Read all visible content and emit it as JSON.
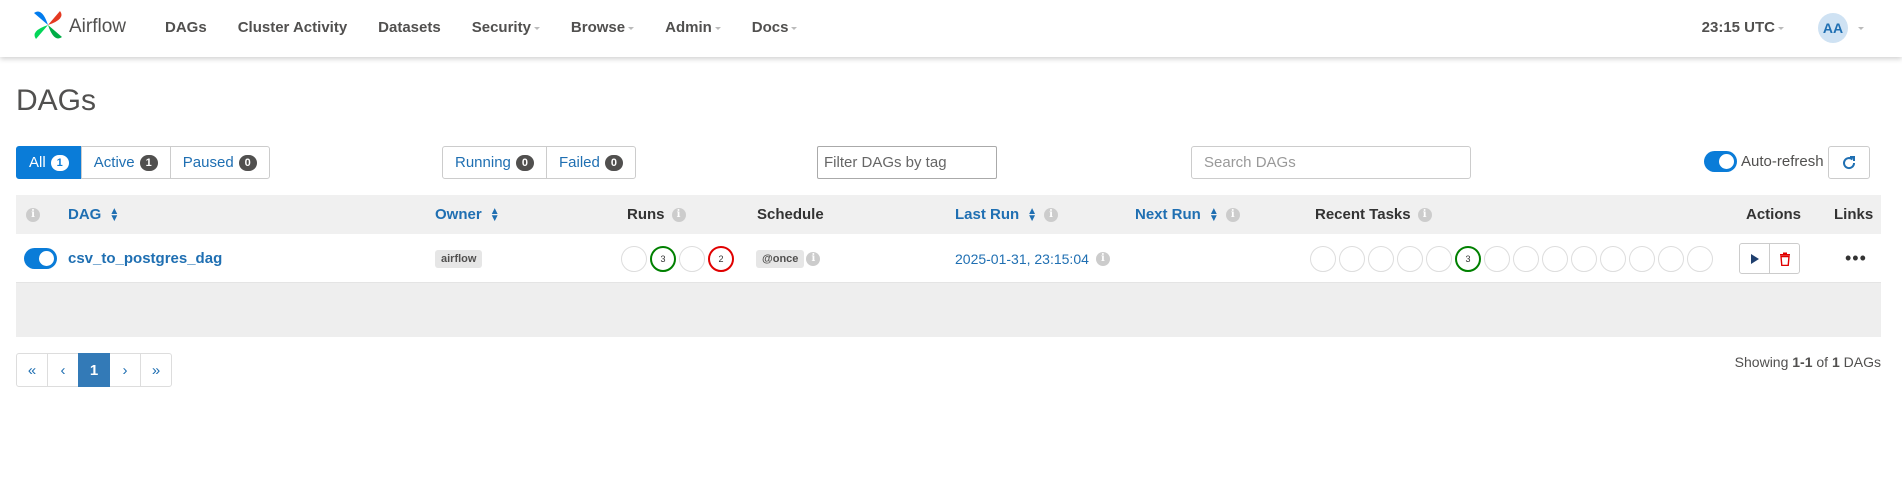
{
  "navbar": {
    "brand": "Airflow",
    "items": [
      {
        "label": "DAGs",
        "dropdown": false
      },
      {
        "label": "Cluster Activity",
        "dropdown": false
      },
      {
        "label": "Datasets",
        "dropdown": false
      },
      {
        "label": "Security",
        "dropdown": true
      },
      {
        "label": "Browse",
        "dropdown": true
      },
      {
        "label": "Admin",
        "dropdown": true
      },
      {
        "label": "Docs",
        "dropdown": true
      }
    ],
    "clock": "23:15 UTC",
    "user_initials": "AA"
  },
  "page": {
    "title": "DAGs"
  },
  "status_filter": [
    {
      "label": "All",
      "count": "1",
      "active": true
    },
    {
      "label": "Active",
      "count": "1",
      "active": false
    },
    {
      "label": "Paused",
      "count": "0",
      "active": false
    }
  ],
  "run_filter": [
    {
      "label": "Running",
      "count": "0"
    },
    {
      "label": "Failed",
      "count": "0"
    }
  ],
  "tag_filter": {
    "placeholder": "Filter DAGs by tag"
  },
  "search": {
    "placeholder": "Search DAGs"
  },
  "auto_refresh": {
    "label": "Auto-refresh",
    "on": true
  },
  "table": {
    "columns": {
      "info": "i",
      "dag": "DAG",
      "owner": "Owner",
      "runs": "Runs",
      "schedule": "Schedule",
      "last_run": "Last Run",
      "next_run": "Next Run",
      "recent_tasks": "Recent Tasks",
      "actions": "Actions",
      "links": "Links"
    },
    "rows": [
      {
        "dag_id": "csv_to_postgres_dag",
        "active": true,
        "owner": "airflow",
        "runs": [
          {
            "count": "",
            "status": "none"
          },
          {
            "count": "3",
            "status": "success"
          },
          {
            "count": "",
            "status": "none"
          },
          {
            "count": "2",
            "status": "failed"
          }
        ],
        "schedule": "@once",
        "last_run": "2025-01-31, 23:15:04",
        "next_run": "",
        "recent_tasks": [
          {
            "count": "",
            "status": "none"
          },
          {
            "count": "",
            "status": "none"
          },
          {
            "count": "",
            "status": "none"
          },
          {
            "count": "",
            "status": "none"
          },
          {
            "count": "",
            "status": "none"
          },
          {
            "count": "3",
            "status": "success"
          },
          {
            "count": "",
            "status": "none"
          },
          {
            "count": "",
            "status": "none"
          },
          {
            "count": "",
            "status": "none"
          },
          {
            "count": "",
            "status": "none"
          },
          {
            "count": "",
            "status": "none"
          },
          {
            "count": "",
            "status": "none"
          },
          {
            "count": "",
            "status": "none"
          },
          {
            "count": "",
            "status": "none"
          }
        ],
        "links_icon": "more-horizontal-icon"
      }
    ]
  },
  "pagination": {
    "first": "«",
    "prev": "‹",
    "current": "1",
    "next": "›",
    "last": "»"
  },
  "showing": {
    "prefix": "Showing ",
    "range": "1-1",
    "middle": " of ",
    "total": "1",
    "suffix": " DAGs"
  },
  "colors": {
    "accent": "#0a7cd8",
    "link": "#1f6fb2",
    "success": "#008000",
    "failed": "#e00000"
  }
}
